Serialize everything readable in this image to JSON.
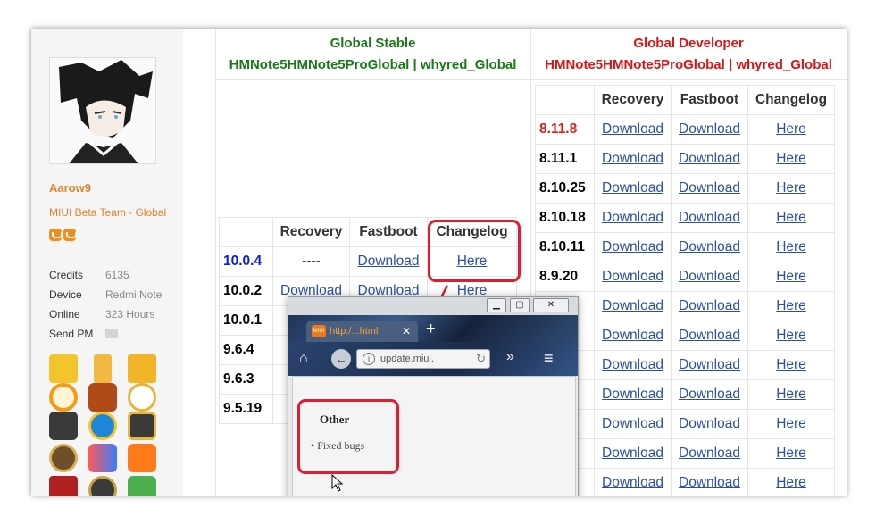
{
  "profile": {
    "username": "Aarow9",
    "usergroup": "MIUI Beta Team - Global",
    "stats": [
      {
        "label": "Credits",
        "value": "6135"
      },
      {
        "label": "Device",
        "value": "Redmi Note"
      },
      {
        "label": "Online",
        "value": "323 Hours"
      },
      {
        "label": "Send PM",
        "value": ""
      }
    ]
  },
  "stable": {
    "title": "Global Stable",
    "subtitle": "HMNote5HMNote5ProGlobal | whyred_Global",
    "headers": [
      "",
      "Recovery",
      "Fastboot",
      "Changelog"
    ],
    "rows": [
      {
        "version": "10.0.4",
        "recovery": "----",
        "fastboot": "Download",
        "changelog": "Here"
      },
      {
        "version": "10.0.2",
        "recovery": "Download",
        "fastboot": "Download",
        "changelog": "Here"
      },
      {
        "version": "10.0.1",
        "recovery": "D",
        "fastboot": "",
        "changelog": ""
      },
      {
        "version": "9.6.4",
        "recovery": "D",
        "fastboot": "",
        "changelog": ""
      },
      {
        "version": "9.6.3",
        "recovery": "D",
        "fastboot": "",
        "changelog": ""
      },
      {
        "version": "9.5.19",
        "recovery": "D",
        "fastboot": "",
        "changelog": ""
      }
    ]
  },
  "developer": {
    "title": "Global Developer",
    "subtitle": "HMNote5HMNote5ProGlobal | whyred_Global",
    "headers": [
      "",
      "Recovery",
      "Fastboot",
      "Changelog"
    ],
    "versions": [
      "8.11.8",
      "8.11.1",
      "8.10.25",
      "8.10.18",
      "8.10.11",
      "8.9.20",
      "",
      "",
      "",
      "",
      "",
      "",
      ""
    ],
    "download_label": "Download",
    "here_label": "Here"
  },
  "popup": {
    "tab_title": "http:/...html",
    "url": "update.miui.",
    "tab_badge": "MIUI",
    "heading": "Other",
    "bullet": "Fixed bugs"
  },
  "colors": {
    "stable_title": "#1a7a1a",
    "developer_title": "#d91414",
    "latest_stable": "#0a1fd4",
    "latest_dev": "#e02020",
    "link": "#2c4fa6",
    "callout": "#e21b2f",
    "user_accent": "#d9842e"
  },
  "icons": [
    "home-icon",
    "back-icon",
    "info-icon",
    "reload-icon",
    "overflow-icon",
    "menu-icon",
    "close-icon",
    "minimize-icon",
    "maximize-icon",
    "plus-icon",
    "mail-icon",
    "cursor-icon"
  ]
}
